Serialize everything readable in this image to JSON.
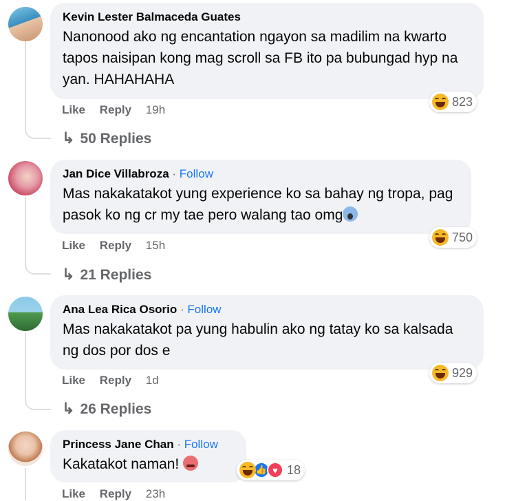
{
  "comments": [
    {
      "author": "Kevin Lester Balmaceda Guates",
      "follow": "",
      "text": "Nanonood ako ng encantation ngayon sa madilim na kwarto tapos naisipan kong mag scroll sa FB ito pa bubungad hyp na yan. HAHAHAHA",
      "reaction_count": "823",
      "like": "Like",
      "reply": "Reply",
      "time": "19h",
      "replies": "50 Replies"
    },
    {
      "author": "Jan Dice Villabroza",
      "follow": "Follow",
      "text": "Mas nakakatakot yung experience ko sa bahay ng tropa, pag pasok ko ng cr my tae pero walang tao omg",
      "reaction_count": "750",
      "like": "Like",
      "reply": "Reply",
      "time": "15h",
      "replies": "21 Replies"
    },
    {
      "author": "Ana Lea Rica Osorio",
      "follow": "Follow",
      "text": "Mas nakakatakot pa yung habulin ako ng tatay ko sa kalsada ng dos por dos e",
      "reaction_count": "929",
      "like": "Like",
      "reply": "Reply",
      "time": "1d",
      "replies": "26 Replies"
    },
    {
      "author": "Princess Jane Chan",
      "follow": "Follow",
      "text": "Kakatakot naman!",
      "reaction_count": "18",
      "like": "Like",
      "reply": "Reply",
      "time": "23h"
    }
  ],
  "separator": "·",
  "icons": {
    "haha": "haha-reaction-icon",
    "like": "like-reaction-icon",
    "love": "love-reaction-icon",
    "reply_arrow": "reply-arrow-icon"
  }
}
